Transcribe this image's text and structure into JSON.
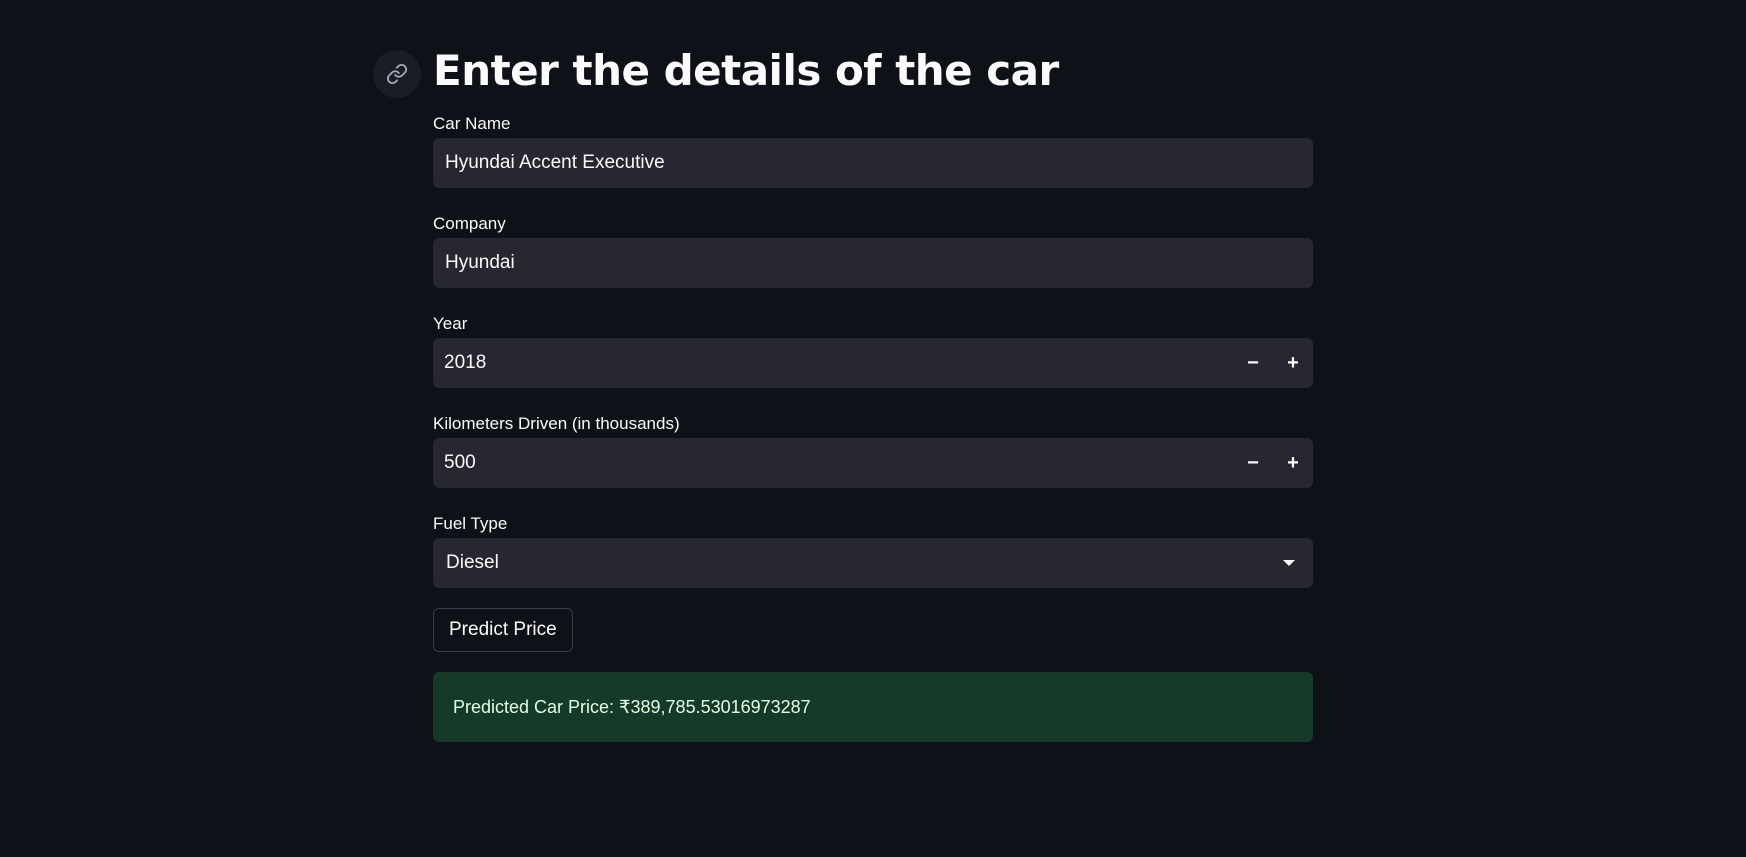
{
  "page": {
    "title": "Enter the details of the car",
    "anchor_icon": "link-icon"
  },
  "fields": {
    "car_name": {
      "label": "Car Name",
      "value": "Hyundai Accent Executive"
    },
    "company": {
      "label": "Company",
      "value": "Hyundai"
    },
    "year": {
      "label": "Year",
      "value": "2018",
      "decrement": "−",
      "increment": "+"
    },
    "kms": {
      "label": "Kilometers Driven (in thousands)",
      "value": "500",
      "decrement": "−",
      "increment": "+"
    },
    "fuel": {
      "label": "Fuel Type",
      "value": "Diesel",
      "caret_icon": "chevron-down-icon"
    }
  },
  "actions": {
    "predict_label": "Predict Price"
  },
  "result": {
    "text": "Predicted Car Price: ₹389,785.53016973287"
  },
  "colors": {
    "background": "#0e1117",
    "input_bg": "#262730",
    "success_bg": "#173928",
    "text": "#fafafa"
  }
}
